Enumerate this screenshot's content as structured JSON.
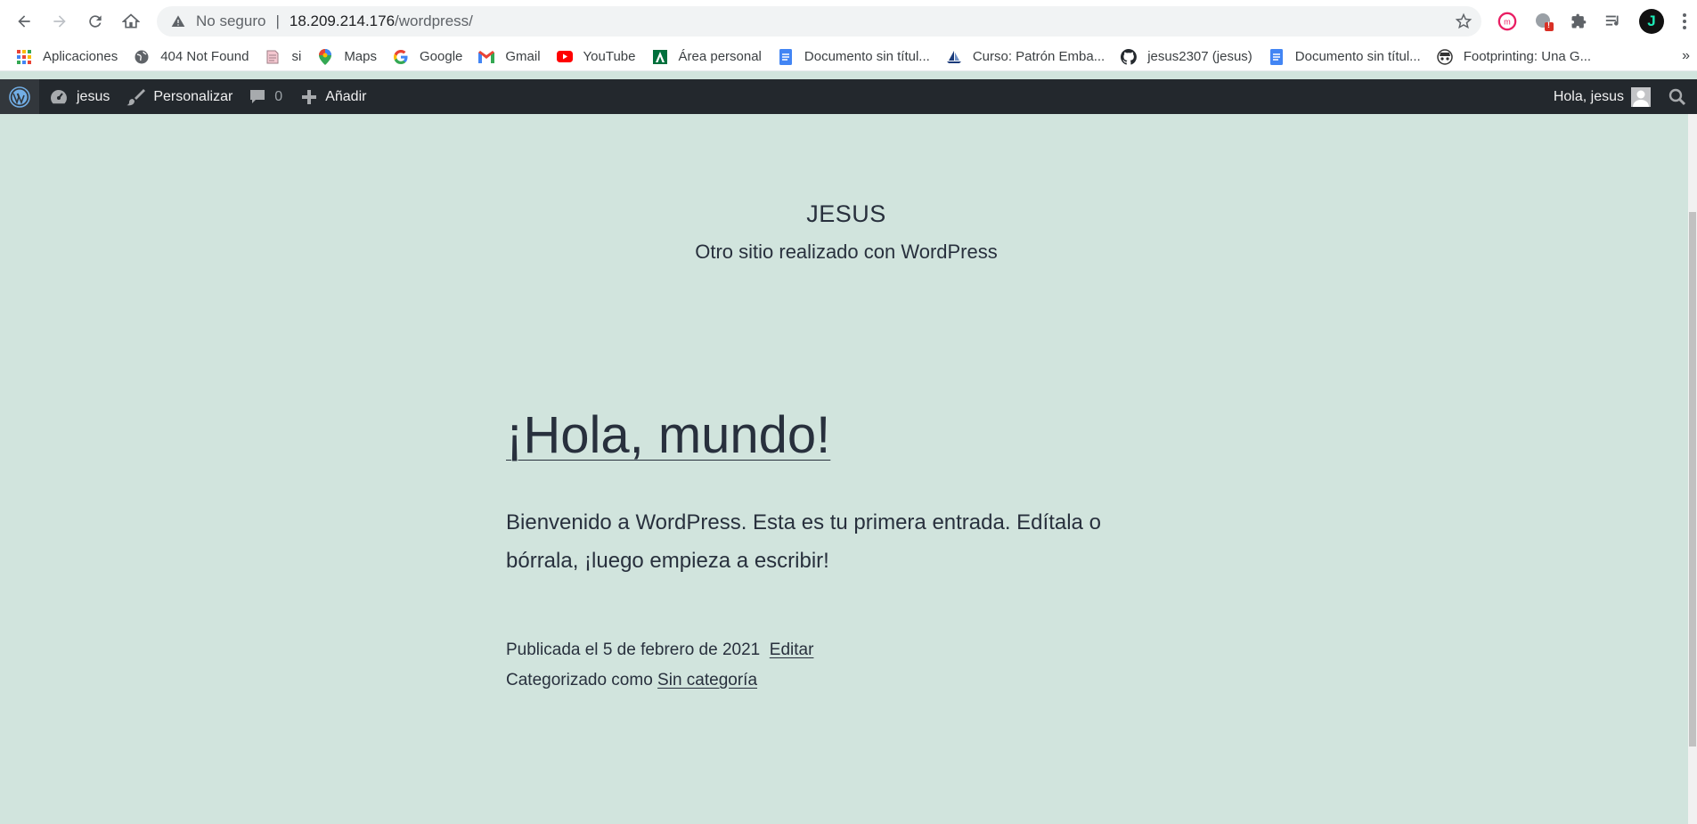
{
  "browser": {
    "insecure_label": "No seguro",
    "url_host": "18.209.214.176",
    "url_path": "/wordpress/",
    "bookmarks": [
      {
        "label": "Aplicaciones",
        "icon": "apps-grid-icon"
      },
      {
        "label": "404 Not Found",
        "icon": "globe-icon"
      },
      {
        "label": "si",
        "icon": "page-icon"
      },
      {
        "label": "Maps",
        "icon": "maps-pin-icon"
      },
      {
        "label": "Google",
        "icon": "google-icon"
      },
      {
        "label": "Gmail",
        "icon": "gmail-icon"
      },
      {
        "label": "YouTube",
        "icon": "youtube-icon"
      },
      {
        "label": "Área personal",
        "icon": "andalucia-icon"
      },
      {
        "label": "Documento sin títul...",
        "icon": "docs-icon"
      },
      {
        "label": "Curso: Patrón Emba...",
        "icon": "sail-icon"
      },
      {
        "label": "jesus2307 (jesus)",
        "icon": "github-icon"
      },
      {
        "label": "Documento sin títul...",
        "icon": "docs-icon"
      },
      {
        "label": "Footprinting: Una G...",
        "icon": "spy-icon"
      }
    ],
    "more_bookmarks": "»",
    "profile_initial": "J",
    "extension_badge": "!"
  },
  "adminbar": {
    "site_name": "jesus",
    "customize": "Personalizar",
    "comments_count": "0",
    "add_new": "Añadir",
    "greeting": "Hola, jesus"
  },
  "site": {
    "title": "JESUS",
    "description": "Otro sitio realizado con WordPress"
  },
  "post": {
    "title": "¡Hola, mundo!",
    "content": "Bienvenido a WordPress. Esta es tu primera entrada. Edítala o bórrala, ¡luego empieza a escribir!",
    "published_prefix": "Publicada el",
    "date": "5 de febrero de 2021",
    "edit_label": "Editar",
    "category_prefix": "Categorizado como",
    "category": "Sin categoría"
  },
  "colors": {
    "page_background": "#d1e4dd",
    "adminbar_background": "#23282d",
    "text": "#28303d"
  }
}
